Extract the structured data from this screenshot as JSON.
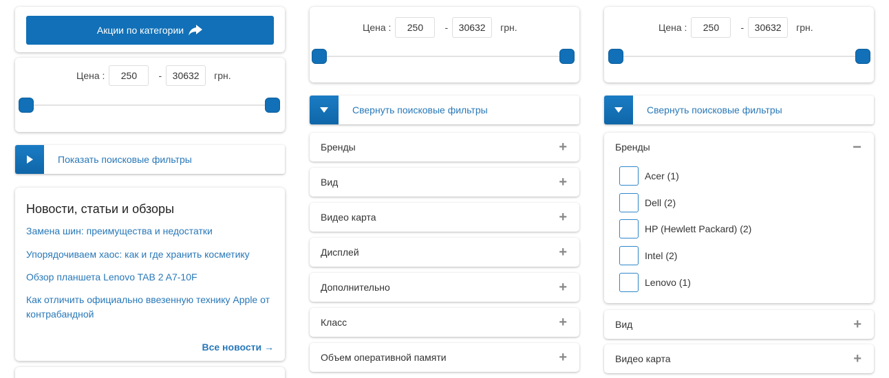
{
  "promo": {
    "label": "Акции по категории",
    "icon": "arrow-share-icon",
    "color": "#1170b7"
  },
  "price": {
    "label": "Цена :",
    "min": "250",
    "max": "30632",
    "dash": "-",
    "currency": "грн."
  },
  "toggles": {
    "show": "Показать поисковые фильтры",
    "collapse": "Свернуть поисковые фильтры"
  },
  "news": {
    "title": "Новости, статьи и обзоры",
    "items": [
      {
        "text": "Замена шин: преимущества и недостатки"
      },
      {
        "text": "Упорядочиваем хаос: как и где хранить косметику"
      },
      {
        "text": "Обзор планшета Lenovo TAB 2 A7-10F"
      },
      {
        "text": "Как отличить официально ввезенную технику Apple от контрабандной"
      }
    ],
    "all": "Все новости →"
  },
  "filters_mid": [
    {
      "label": "Бренды"
    },
    {
      "label": "Вид"
    },
    {
      "label": "Видео карта"
    },
    {
      "label": "Дисплей"
    },
    {
      "label": "Дополнительно"
    },
    {
      "label": "Класс"
    },
    {
      "label": "Объем оперативной памяти"
    }
  ],
  "filters_right": {
    "brands_label": "Бренды",
    "brands": [
      {
        "label": "Acer (1)"
      },
      {
        "label": "Dell (2)"
      },
      {
        "label": "HP (Hewlett Packard) (2)"
      },
      {
        "label": "Intel (2)"
      },
      {
        "label": "Lenovo (1)"
      }
    ],
    "rows": [
      {
        "label": "Вид"
      },
      {
        "label": "Видео карта"
      }
    ]
  },
  "icons": {
    "plus": "+",
    "minus": "−"
  }
}
